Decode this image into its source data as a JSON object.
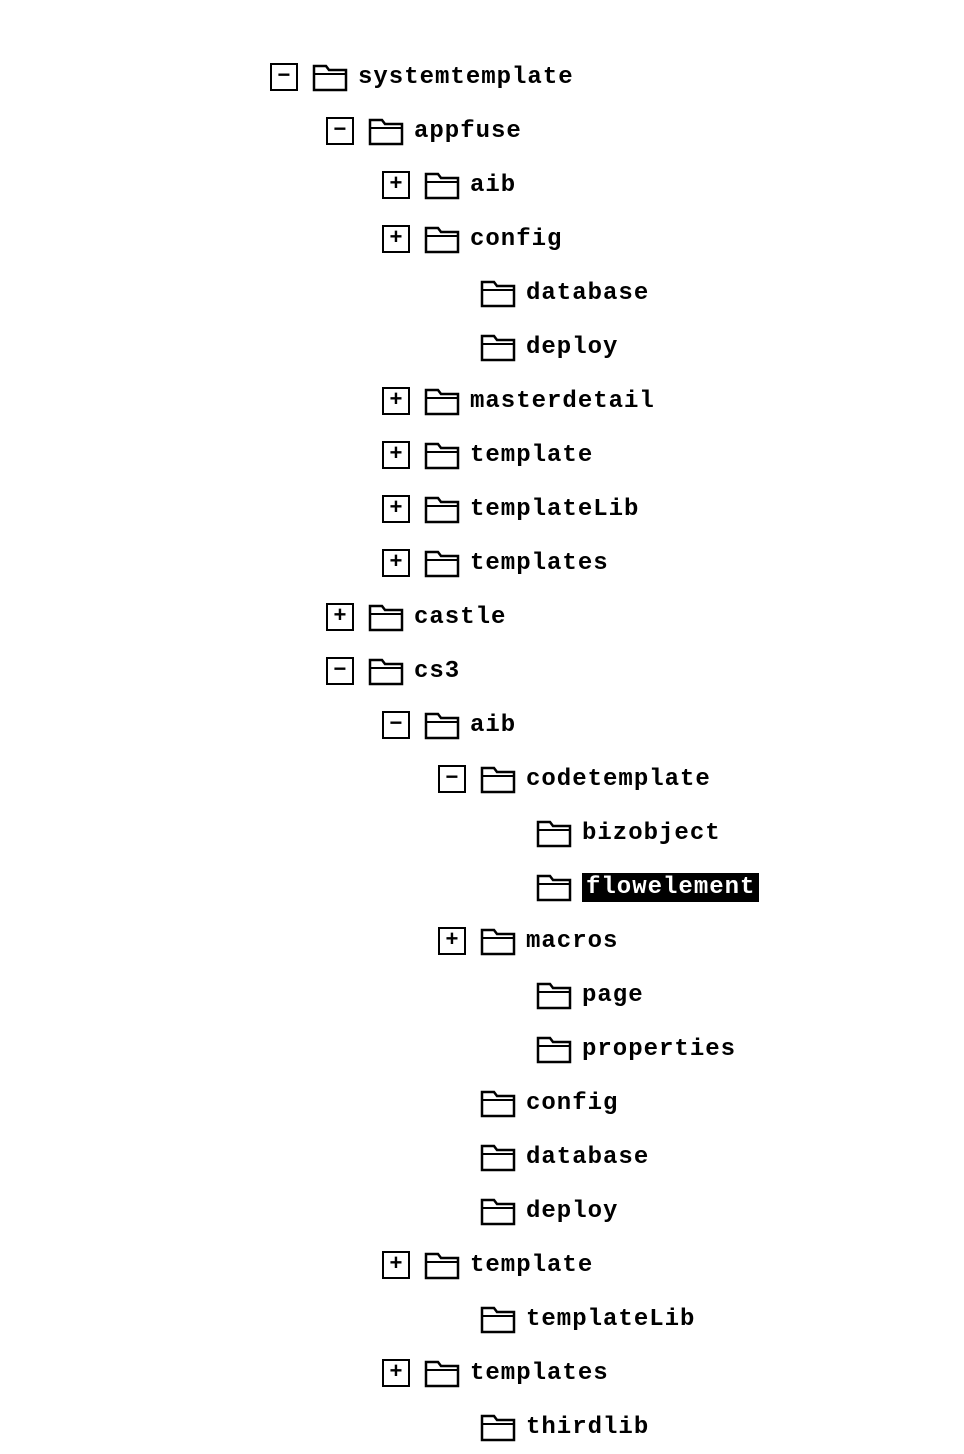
{
  "tree": {
    "expand_plus": "+",
    "expand_minus": "−",
    "nodes": [
      {
        "indent": 0,
        "box": "minus",
        "label": "systemtemplate",
        "name": "node-systemtemplate",
        "selected": false
      },
      {
        "indent": 1,
        "box": "minus",
        "label": "appfuse",
        "name": "node-appfuse",
        "selected": false
      },
      {
        "indent": 2,
        "box": "plus",
        "label": "aib",
        "name": "node-appfuse-aib",
        "selected": false
      },
      {
        "indent": 2,
        "box": "plus",
        "label": "config",
        "name": "node-appfuse-config",
        "selected": false
      },
      {
        "indent": 3,
        "box": "none",
        "label": "database",
        "name": "node-appfuse-database",
        "selected": false
      },
      {
        "indent": 3,
        "box": "none",
        "label": "deploy",
        "name": "node-appfuse-deploy",
        "selected": false
      },
      {
        "indent": 2,
        "box": "plus",
        "label": "masterdetail",
        "name": "node-appfuse-masterdetail",
        "selected": false
      },
      {
        "indent": 2,
        "box": "plus",
        "label": "template",
        "name": "node-appfuse-template",
        "selected": false
      },
      {
        "indent": 2,
        "box": "plus",
        "label": "templateLib",
        "name": "node-appfuse-templatelib",
        "selected": false
      },
      {
        "indent": 2,
        "box": "plus",
        "label": "templates",
        "name": "node-appfuse-templates",
        "selected": false
      },
      {
        "indent": 1,
        "box": "plus",
        "label": "castle",
        "name": "node-castle",
        "selected": false
      },
      {
        "indent": 1,
        "box": "minus",
        "label": "cs3",
        "name": "node-cs3",
        "selected": false
      },
      {
        "indent": 2,
        "box": "minus",
        "label": "aib",
        "name": "node-cs3-aib",
        "selected": false
      },
      {
        "indent": 3,
        "box": "minus",
        "label": "codetemplate",
        "name": "node-cs3-codetemplate",
        "selected": false
      },
      {
        "indent": 4,
        "box": "none",
        "label": "bizobject",
        "name": "node-cs3-bizobject",
        "selected": false
      },
      {
        "indent": 4,
        "box": "none",
        "label": "flowelement",
        "name": "node-cs3-flowelement",
        "selected": true
      },
      {
        "indent": 3,
        "box": "plus",
        "label": "macros",
        "name": "node-cs3-macros",
        "selected": false
      },
      {
        "indent": 4,
        "box": "none",
        "label": "page",
        "name": "node-cs3-page",
        "selected": false
      },
      {
        "indent": 4,
        "box": "none",
        "label": "properties",
        "name": "node-cs3-properties",
        "selected": false
      },
      {
        "indent": 3,
        "box": "none",
        "label": "config",
        "name": "node-cs3-config",
        "selected": false
      },
      {
        "indent": 3,
        "box": "none",
        "label": "database",
        "name": "node-cs3-database",
        "selected": false
      },
      {
        "indent": 3,
        "box": "none",
        "label": "deploy",
        "name": "node-cs3-deploy",
        "selected": false
      },
      {
        "indent": 2,
        "box": "plus",
        "label": "template",
        "name": "node-cs3-template",
        "selected": false
      },
      {
        "indent": 3,
        "box": "none",
        "label": "templateLib",
        "name": "node-cs3-templatelib",
        "selected": false
      },
      {
        "indent": 2,
        "box": "plus",
        "label": "templates",
        "name": "node-cs3-templates",
        "selected": false
      },
      {
        "indent": 3,
        "box": "none",
        "label": "thirdlib",
        "name": "node-cs3-thirdlib",
        "selected": false
      }
    ]
  }
}
